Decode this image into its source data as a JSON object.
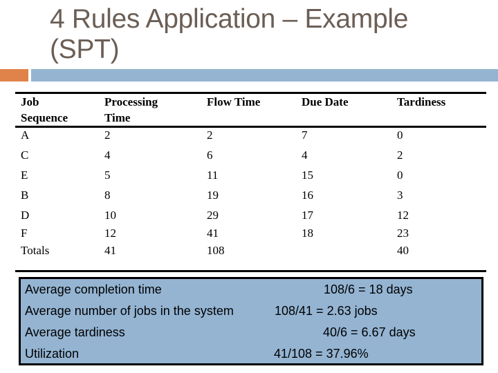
{
  "slide": {
    "title_line1": "4 Rules Application – Example",
    "title_line2": "(SPT)",
    "colors": {
      "accent_orange": "#e0834a",
      "accent_blue": "#94b4d2",
      "title_text": "#6b5e55"
    }
  },
  "table": {
    "headers": [
      [
        "Job",
        "Sequence"
      ],
      [
        "Processing",
        "Time"
      ],
      [
        "Flow Time",
        ""
      ],
      [
        "Due Date",
        ""
      ],
      [
        "Tardiness",
        ""
      ]
    ],
    "rows": [
      [
        "A",
        "2",
        "2",
        "7",
        "0"
      ],
      [
        "C",
        "4",
        "6",
        "4",
        "2"
      ],
      [
        "E",
        "5",
        "11",
        "15",
        "0"
      ],
      [
        "B",
        "8",
        "19",
        "16",
        "3"
      ],
      [
        "D",
        "10",
        "29",
        "17",
        "12"
      ],
      [
        "F",
        "12",
        "41",
        "18",
        "23"
      ],
      [
        "Totals",
        "41",
        "108",
        "",
        "40"
      ]
    ]
  },
  "summary": {
    "items": [
      {
        "label": "Average completion time",
        "value": "108/6 = 18 days"
      },
      {
        "label": "Average number of jobs in the system",
        "value": "108/41 = 2.63 jobs"
      },
      {
        "label": "Average tardiness",
        "value": "40/6 = 6.67 days"
      },
      {
        "label": "Utilization",
        "value": "41/108 = 37.96%"
      }
    ]
  }
}
